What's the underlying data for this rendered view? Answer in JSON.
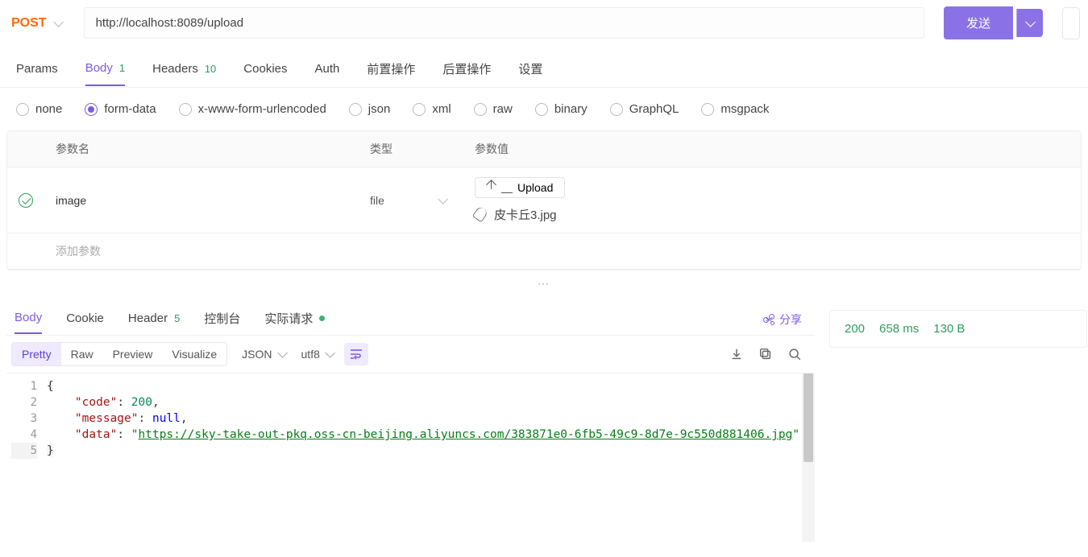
{
  "request": {
    "method": "POST",
    "url": "http://localhost:8089/upload",
    "send_label": "发送",
    "tabs": [
      {
        "key": "params",
        "label": "Params",
        "badge": null
      },
      {
        "key": "body",
        "label": "Body",
        "badge": "1",
        "active": true
      },
      {
        "key": "headers",
        "label": "Headers",
        "badge": "10"
      },
      {
        "key": "cookies",
        "label": "Cookies"
      },
      {
        "key": "auth",
        "label": "Auth"
      },
      {
        "key": "pre",
        "label": "前置操作"
      },
      {
        "key": "post",
        "label": "后置操作"
      },
      {
        "key": "settings",
        "label": "设置"
      }
    ],
    "body_types": [
      {
        "key": "none",
        "label": "none"
      },
      {
        "key": "form-data",
        "label": "form-data",
        "selected": true
      },
      {
        "key": "x-www",
        "label": "x-www-form-urlencoded"
      },
      {
        "key": "json",
        "label": "json"
      },
      {
        "key": "xml",
        "label": "xml"
      },
      {
        "key": "raw",
        "label": "raw"
      },
      {
        "key": "binary",
        "label": "binary"
      },
      {
        "key": "graphql",
        "label": "GraphQL"
      },
      {
        "key": "msgpack",
        "label": "msgpack"
      }
    ],
    "table": {
      "col_name": "参数名",
      "col_type": "类型",
      "col_value": "参数值",
      "add_placeholder": "添加参数",
      "row": {
        "checked": true,
        "name": "image",
        "type": "file",
        "upload_label": "Upload",
        "filename": "皮卡丘3.jpg"
      }
    }
  },
  "response": {
    "tabs": [
      {
        "key": "body",
        "label": "Body",
        "active": true
      },
      {
        "key": "cookie",
        "label": "Cookie"
      },
      {
        "key": "header",
        "label": "Header",
        "badge": "5"
      },
      {
        "key": "console",
        "label": "控制台"
      },
      {
        "key": "actual",
        "label": "实际请求",
        "dot": true
      }
    ],
    "share_label": "分享",
    "toolbar": {
      "segments": [
        "Pretty",
        "Raw",
        "Preview",
        "Visualize"
      ],
      "active_segment": "Pretty",
      "format": "JSON",
      "encoding": "utf8"
    },
    "json": {
      "code": 200,
      "message": null,
      "data": "https://sky-take-out-pkq.oss-cn-beijing.aliyuncs.com/383871e0-6fb5-49c9-8d7e-9c550d881406.jpg"
    },
    "status": {
      "code": "200",
      "time": "658 ms",
      "size": "130 B"
    }
  }
}
